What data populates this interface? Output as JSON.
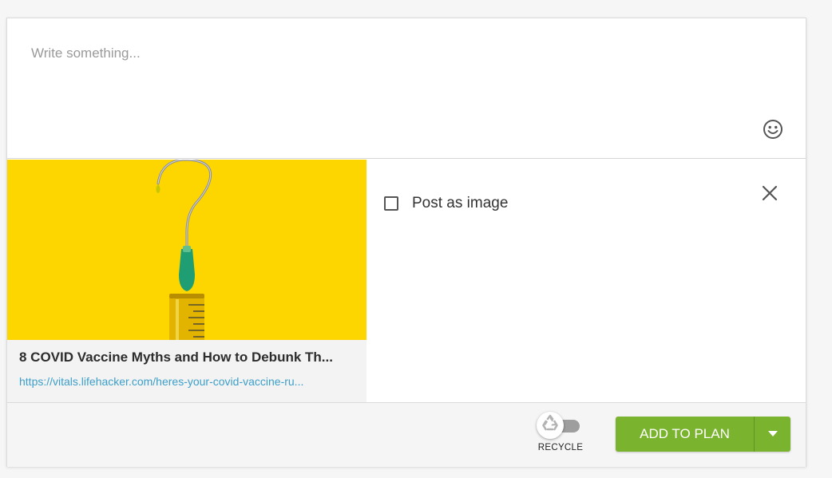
{
  "composer": {
    "placeholder": "Write something...",
    "emoji_icon": "smiley-face-icon"
  },
  "link_preview": {
    "image_description_icon": "syringe-question-mark-image",
    "image_background": "#fdd600",
    "title": "8 COVID Vaccine Myths and How to Debunk Th...",
    "url": "https://vitals.lifehacker.com/heres-your-covid-vaccine-ru..."
  },
  "options": {
    "post_as_image_label": "Post as image",
    "post_as_image_checked": false,
    "close_icon": "close-icon"
  },
  "footer": {
    "recycle_label": "RECYCLE",
    "recycle_enabled": false,
    "add_to_plan_label": "ADD TO PLAN",
    "dropdown_icon": "caret-down-icon",
    "accent_color": "#7ab42e",
    "link_color": "#3d9fc9"
  }
}
